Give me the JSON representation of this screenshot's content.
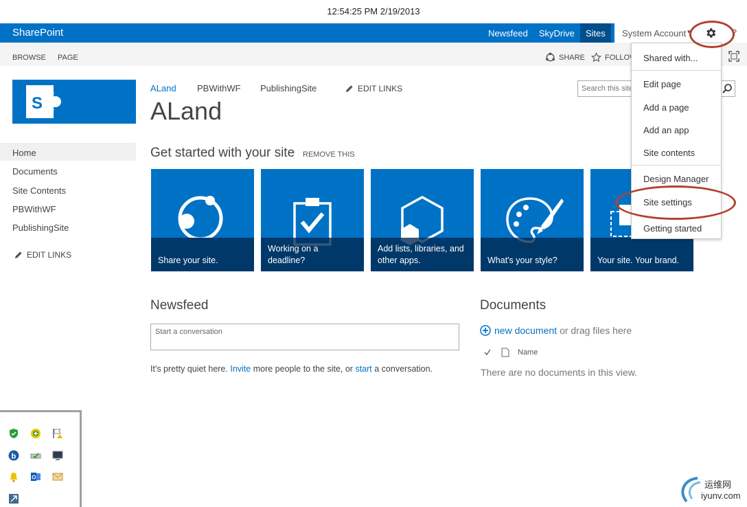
{
  "clock": "12:54:25 PM 2/19/2013",
  "suitebar": {
    "brand": "SharePoint",
    "links": [
      {
        "label": "Newsfeed",
        "active": false
      },
      {
        "label": "SkyDrive",
        "active": false
      },
      {
        "label": "Sites",
        "active": true
      }
    ],
    "user": "System Account",
    "user_caret": "▾",
    "help": "?",
    "accent": "#0072c6"
  },
  "ribbon": {
    "tabs": [
      "BROWSE",
      "PAGE"
    ],
    "share": "SHARE",
    "follow": "FOLLOW"
  },
  "topnav": {
    "items": [
      "ALand",
      "PBWithWF",
      "PublishingSite"
    ],
    "edit_links": "EDIT LINKS"
  },
  "page_title": "ALand",
  "search": {
    "placeholder": "Search this site"
  },
  "quicklaunch": {
    "items": [
      "Home",
      "Documents",
      "Site Contents",
      "PBWithWF",
      "PublishingSite"
    ],
    "edit_links": "EDIT LINKS"
  },
  "get_started": {
    "heading": "Get started with your site",
    "remove": "REMOVE THIS",
    "tiles": [
      {
        "caption": "Share your site.",
        "icon": "share-icon"
      },
      {
        "caption": "Working on a deadline?",
        "icon": "clipboard-check-icon"
      },
      {
        "caption": "Add lists, libraries, and other apps.",
        "icon": "hexagon-icon"
      },
      {
        "caption": "What's your style?",
        "icon": "palette-icon"
      },
      {
        "caption": "Your site. Your brand.",
        "icon": "brand-icon"
      }
    ]
  },
  "newsfeed": {
    "heading": "Newsfeed",
    "placeholder": "Start a conversation",
    "quiet_pre": "It's pretty quiet here.",
    "invite": "Invite",
    "quiet_mid": "more people to the site, or",
    "start": "start",
    "quiet_post": "a conversation."
  },
  "documents": {
    "heading": "Documents",
    "new_document": "new document",
    "drag": "or drag files here",
    "col_name": "Name",
    "empty": "There are no documents in this view."
  },
  "settings_menu": {
    "items": [
      "Shared with...",
      "Edit page",
      "Add a page",
      "Add an app",
      "Site contents",
      "Design Manager",
      "Site settings",
      "Getting started"
    ]
  },
  "watermark": {
    "cn": "运维网",
    "en": "iyunv.com"
  }
}
